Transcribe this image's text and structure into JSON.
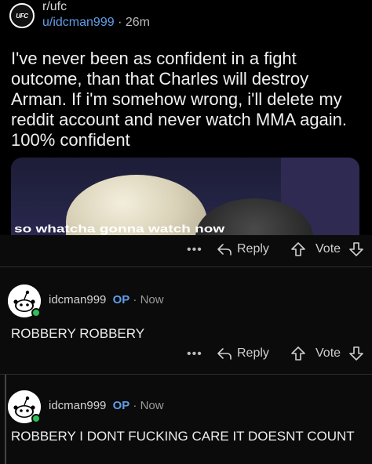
{
  "post": {
    "subreddit": "r/ufc",
    "subreddit_logo_text": "UFC",
    "author": "u/idcman999",
    "separator": "·",
    "age": "26m",
    "title": "I've never been as confident in a fight outcome, than that Charles will destroy Arman. If i'm somehow wrong, i'll delete my reddit account and never watch MMA again. 100% confident",
    "media_caption": "so whatcha gonna watch now",
    "actions": {
      "more": "•••",
      "reply": "Reply",
      "vote": "Vote"
    }
  },
  "comments": [
    {
      "username": "idcman999",
      "op_badge": "OP",
      "separator": "·",
      "time": "Now",
      "body": "ROBBERY ROBBERY",
      "actions": {
        "more": "•••",
        "reply": "Reply",
        "vote": "Vote"
      }
    },
    {
      "username": "idcman999",
      "op_badge": "OP",
      "separator": "·",
      "time": "Now",
      "body": "ROBBERY I DONT FUCKING CARE IT DOESNT COUNT"
    }
  ],
  "colors": {
    "background": "#000000",
    "link_blue": "#5f9de8",
    "online_green": "#2fbf57"
  }
}
